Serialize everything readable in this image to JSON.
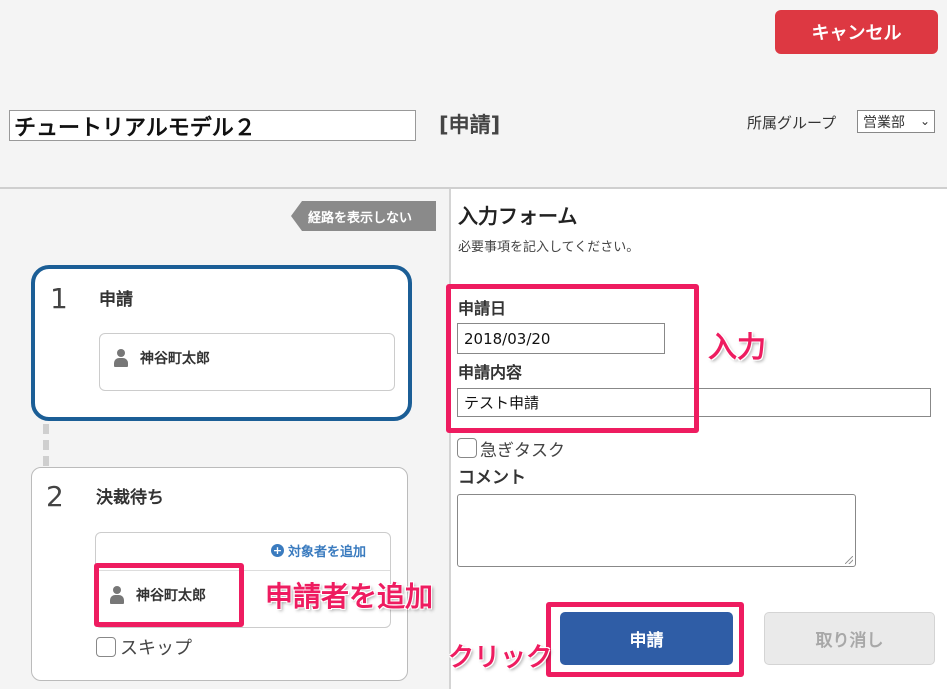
{
  "header": {
    "cancel_label": "キャンセル",
    "title_value": "チュートリアルモデル２",
    "form_kind": "[申請]",
    "group_label": "所属グループ",
    "group_selected": "営業部",
    "cancel_color": "#dd3842"
  },
  "route": {
    "toggle_label": "経路を表示しない",
    "steps": [
      {
        "number": "1",
        "title": "申請",
        "person": "神谷町太郎"
      },
      {
        "number": "2",
        "title": "決裁待ち",
        "person": "神谷町太郎",
        "add_label": "対象者を追加",
        "skip_label": "スキップ"
      }
    ]
  },
  "form": {
    "title": "入力フォーム",
    "description": "必要事項を記入してください。",
    "fields": [
      {
        "label": "申請日",
        "value": "2018/03/20"
      },
      {
        "label": "申請内容",
        "value": "テスト申請"
      }
    ],
    "urgent_label": "急ぎタスク",
    "comment_label": "コメント",
    "comment_value": "",
    "submit_label": "申請",
    "undo_label": "取り消し",
    "submit_color": "#2f5da6"
  },
  "annotations": {
    "input": "入力",
    "add_applicant": "申請者を追加",
    "click": "クリック",
    "color": "#ee1c60"
  }
}
